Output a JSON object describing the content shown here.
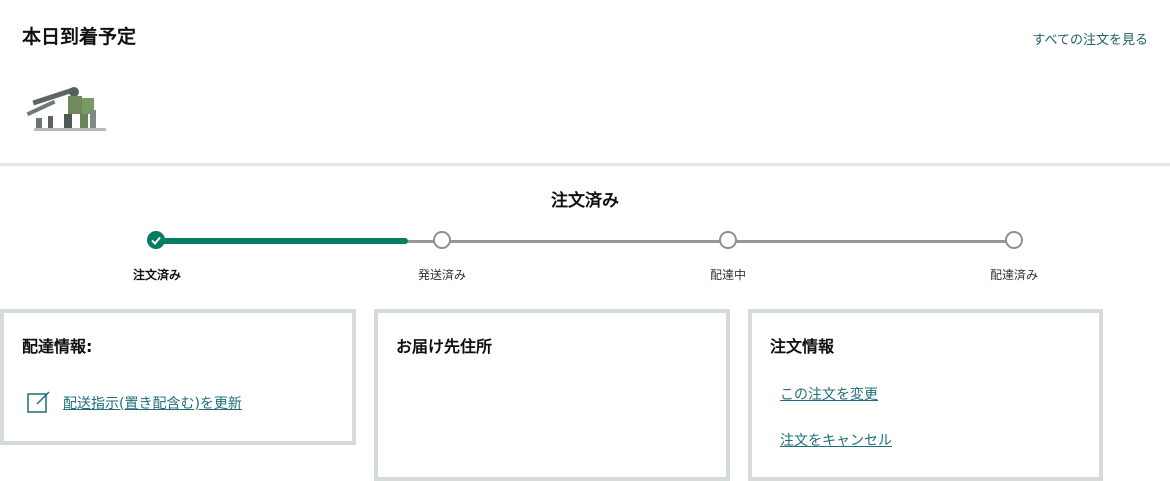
{
  "header": {
    "title": "本日到着予定",
    "all_orders_link": "すべての注文を見る"
  },
  "product": {
    "image_icon": "robot-figure-product-image"
  },
  "status": {
    "title": "注文済み",
    "progress_fraction": 0.294,
    "steps": [
      {
        "label": "注文済み",
        "state": "done"
      },
      {
        "label": "発送済み",
        "state": "pending"
      },
      {
        "label": "配達中",
        "state": "pending"
      },
      {
        "label": "配達済み",
        "state": "pending"
      }
    ]
  },
  "cards": {
    "delivery": {
      "title": "配達情報:",
      "update_link": "配送指示(置き配含む)を更新",
      "icon": "edit-icon"
    },
    "address": {
      "title": "お届け先住所"
    },
    "order": {
      "title": "注文情報",
      "change_link": "この注文を変更",
      "cancel_link": "注文をキャンセル"
    }
  },
  "colors": {
    "accent": "#067d62",
    "link": "#1f6f7a",
    "track": "#979797",
    "border": "#d5dbdb"
  }
}
